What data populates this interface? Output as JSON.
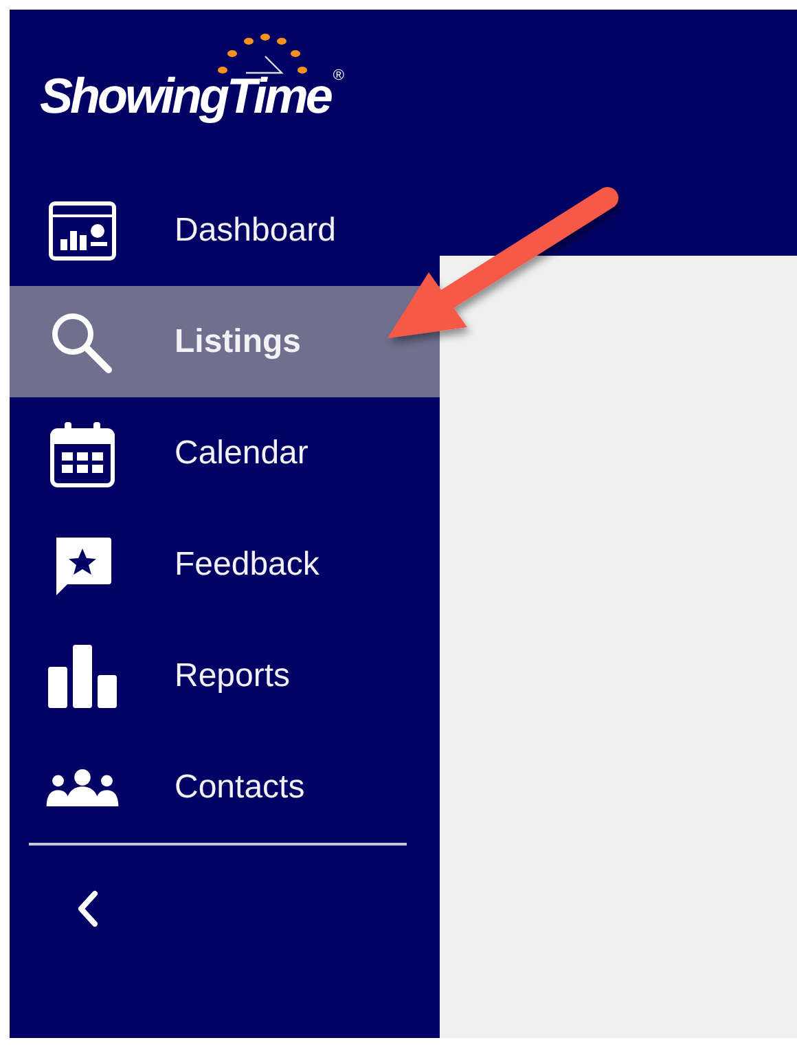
{
  "logo": {
    "name": "ShowingTime",
    "mark": "®"
  },
  "sidebar": {
    "items": [
      {
        "kind": "dashboard",
        "label": "Dashboard",
        "selected": false
      },
      {
        "kind": "search",
        "label": "Listings",
        "selected": true
      },
      {
        "kind": "calendar",
        "label": "Calendar",
        "selected": false
      },
      {
        "kind": "feedback",
        "label": "Feedback",
        "selected": false
      },
      {
        "kind": "reports",
        "label": "Reports",
        "selected": false
      },
      {
        "kind": "contacts",
        "label": "Contacts",
        "selected": false
      }
    ]
  }
}
